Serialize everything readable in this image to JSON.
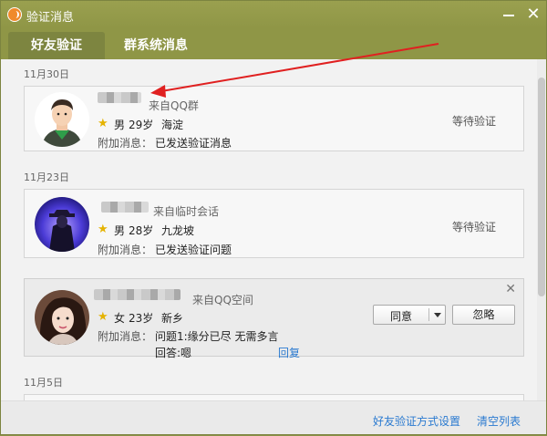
{
  "window": {
    "title": "验证消息"
  },
  "tabs": [
    {
      "label": "好友验证",
      "active": true
    },
    {
      "label": "群系统消息",
      "active": false
    }
  ],
  "requests": [
    {
      "date": "11月30日",
      "source": "来自QQ群",
      "gender": "男",
      "age": "29岁",
      "location": "海淀",
      "msg_label": "附加消息：",
      "message": "已发送验证消息",
      "status": "等待验证"
    },
    {
      "date": "11月23日",
      "source": "来自临时会话",
      "gender": "男",
      "age": "28岁",
      "location": "九龙坡",
      "msg_label": "附加消息：",
      "message": "已发送验证问题",
      "status": "等待验证"
    },
    {
      "source": "来自QQ空间",
      "gender": "女",
      "age": "23岁",
      "location": "新乡",
      "msg_label": "附加消息：",
      "message": "问题1:缘分已尽 无需多言",
      "answer": "回答:嗯",
      "reply_label": "回复",
      "agree_label": "同意",
      "ignore_label": "忽略"
    }
  ],
  "next_date": "11月5日",
  "footer": {
    "settings_link": "好友验证方式设置",
    "clear_link": "清空列表"
  },
  "colors": {
    "titlebar": "#8f9646",
    "link": "#2a7ad0",
    "star": "#e5b300",
    "arrow": "#e02020"
  }
}
